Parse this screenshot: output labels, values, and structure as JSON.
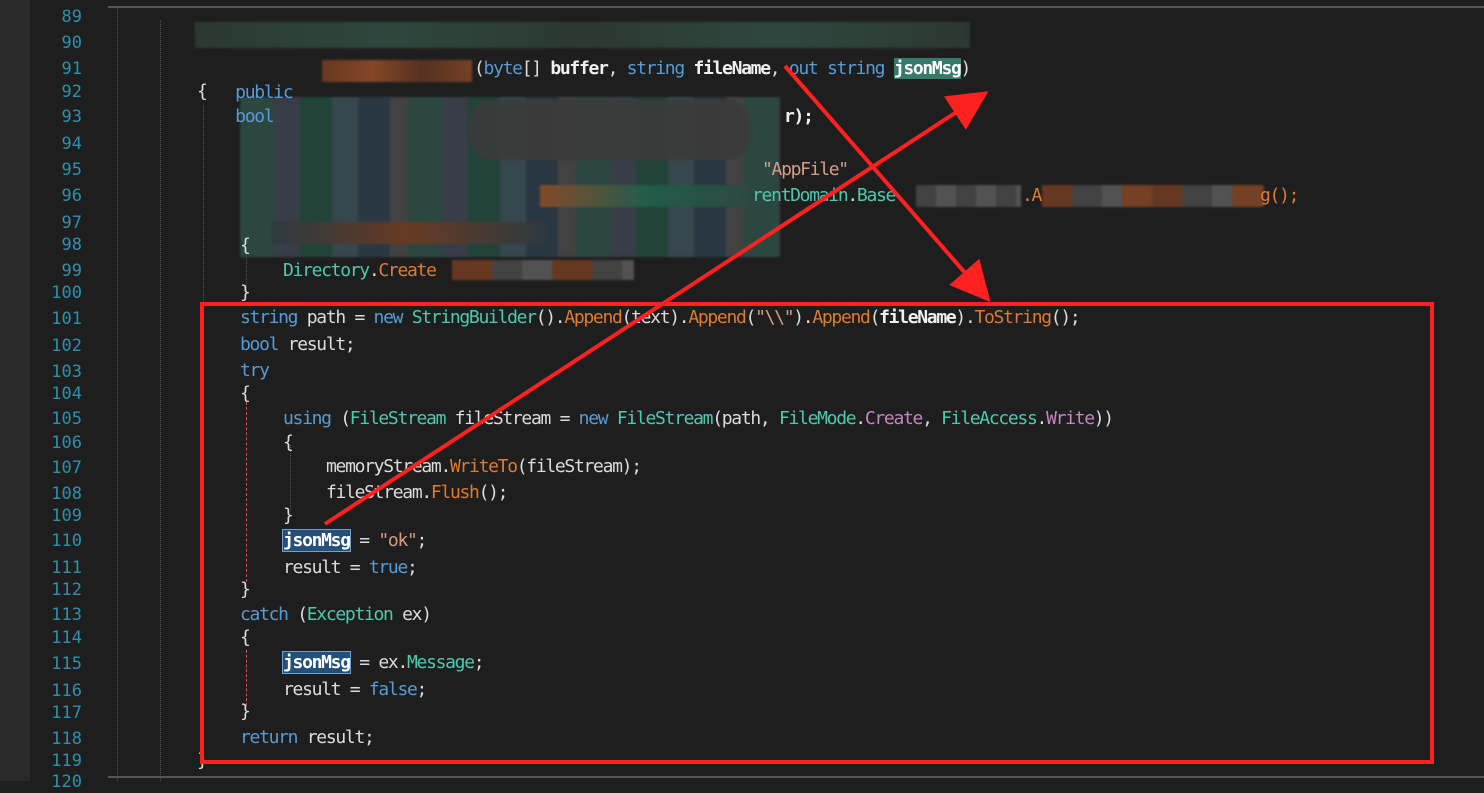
{
  "line_numbers": [
    "89",
    "90",
    "91",
    "92",
    "93",
    "94",
    "95",
    "96",
    "97",
    "98",
    "99",
    "100",
    "101",
    "102",
    "103",
    "104",
    "105",
    "106",
    "107",
    "108",
    "109",
    "110",
    "111",
    "112",
    "113",
    "114",
    "115",
    "116",
    "117",
    "118",
    "119",
    "120"
  ],
  "code": {
    "l91": {
      "kw1": "public",
      "kw2": "bool",
      "p_open": "(",
      "byte": "byte",
      "arr": "[]",
      "buffer": "buffer",
      "c1": ",",
      "string1": "string",
      "fileName": "fileName",
      "c2": ",",
      "out": "out",
      "string2": "string",
      "jsonMsg": "jsonMsg",
      "p_close": ")"
    },
    "l92": {
      "brace": "{"
    },
    "l93": {
      "tail": "r);"
    },
    "l95": {
      "str": "\"AppFile\""
    },
    "l96": {
      "a": "rentDomain",
      "dot": ".",
      "b": "Base",
      "c": ".A",
      "d": "g();"
    },
    "l98": {
      "brace": "{"
    },
    "l99": {
      "ty": "Directory",
      "dot": ".",
      "me": "Create"
    },
    "l100": {
      "brace": "}"
    },
    "l101": {
      "string": "string",
      "path": " path = ",
      "new": "new",
      "sb": "StringBuilder",
      "p1": "().",
      "ap1": "Append",
      "p2": "(text).",
      "ap2": "Append",
      "p3": "(",
      "s": "\"\\\\\"",
      "p4": ").",
      "ap3": "Append",
      "p5": "(",
      "fn": "fileName",
      "p6": ").",
      "ts": "ToString",
      "p7": "();"
    },
    "l102": {
      "bool": "bool",
      "rest": " result;"
    },
    "l103": {
      "try": "try"
    },
    "l104": {
      "brace": "{"
    },
    "l105": {
      "using": "using",
      "p1": " (",
      "fs1": "FileStream",
      "p2": " fileStream = ",
      "new": "new",
      "fs2": "FileStream",
      "p3": "(path, ",
      "fm": "FileMode",
      "d1": ".",
      "cr": "Create",
      "p4": ", ",
      "fa": "FileAccess",
      "d2": ".",
      "wr": "Write",
      "p5": "))"
    },
    "l106": {
      "brace": "{"
    },
    "l107": {
      "a": "memoryStream.",
      "wt": "WriteTo",
      "b": "(fileStream);"
    },
    "l108": {
      "a": "fileStream.",
      "fl": "Flush",
      "b": "();"
    },
    "l109": {
      "brace": "}"
    },
    "l110": {
      "jm": "jsonMsg",
      "eq": " = ",
      "ok": "\"ok\"",
      "sc": ";"
    },
    "l111": {
      "a": "result = ",
      "tr": "true",
      "sc": ";"
    },
    "l112": {
      "brace": "}"
    },
    "l113": {
      "catch": "catch",
      "p1": " (",
      "ex": "Exception",
      "p2": " ex)"
    },
    "l114": {
      "brace": "{"
    },
    "l115": {
      "jm": "jsonMsg",
      "a": " = ex.",
      "msg": "Message",
      "sc": ";"
    },
    "l116": {
      "a": "result = ",
      "fa": "false",
      "sc": ";"
    },
    "l117": {
      "brace": "}"
    },
    "l118": {
      "ret": "return",
      "a": " result;"
    },
    "l119": {
      "brace": "}"
    }
  },
  "colors": {
    "annotation_red": "#ff2020",
    "line_number": "#2b91af",
    "keyword": "#569cd6",
    "type": "#4ec9b0",
    "method": "#e07a30"
  }
}
